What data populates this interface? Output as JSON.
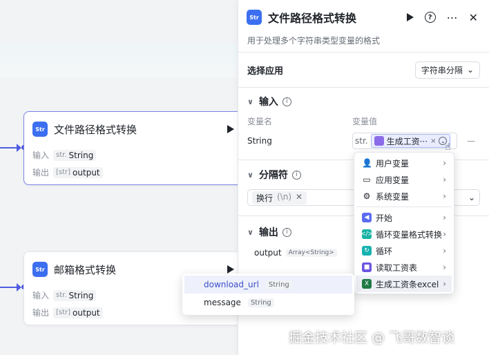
{
  "canvas": {
    "node1": {
      "title": "文件路径格式转换",
      "input_label": "输入",
      "input_prefix": "str.",
      "input_value": "String",
      "output_label": "输出",
      "output_prefix": "[str]",
      "output_value": "output"
    },
    "node2": {
      "title": "邮箱格式转换",
      "input_label": "输入",
      "input_prefix": "str.",
      "input_value": "String",
      "output_label": "输出",
      "output_prefix": "[str]",
      "output_value": "output"
    }
  },
  "panel": {
    "title": "文件路径格式转换",
    "description": "用于处理多个字符串类型变量的格式",
    "select_app_label": "选择应用",
    "select_app_value": "字符串分隔",
    "input_section": "输入",
    "col_var_name": "变量名",
    "col_var_value": "变量值",
    "var_name": "String",
    "var_prefix": "str.",
    "var_chip": "生成工资···",
    "separator_section": "分隔符",
    "separator_value": "换行",
    "separator_hint": "(\\n)",
    "output_section": "输出",
    "output_name": "output",
    "output_type": "Array<String>"
  },
  "var_dropdown": {
    "items": [
      {
        "label": "用户变量",
        "icon": "user-icon"
      },
      {
        "label": "应用变量",
        "icon": "folder-icon"
      },
      {
        "label": "系统变量",
        "icon": "gear-icon"
      },
      {
        "label": "开始",
        "icon": "start-icon"
      },
      {
        "label": "循环变量格式转换",
        "icon": "code-icon"
      },
      {
        "label": "循环",
        "icon": "loop-icon"
      },
      {
        "label": "读取工资表",
        "icon": "box-icon"
      },
      {
        "label": "生成工资条excel",
        "icon": "excel-icon"
      }
    ]
  },
  "output_dropdown": {
    "items": [
      {
        "name": "download_url",
        "type": "String"
      },
      {
        "name": "message",
        "type": "String"
      }
    ]
  },
  "watermark": "掘金技术社区 @ 飞哥数智谈",
  "colors": {
    "accent": "#4e5ce0",
    "brand": "#3c6ff0"
  }
}
